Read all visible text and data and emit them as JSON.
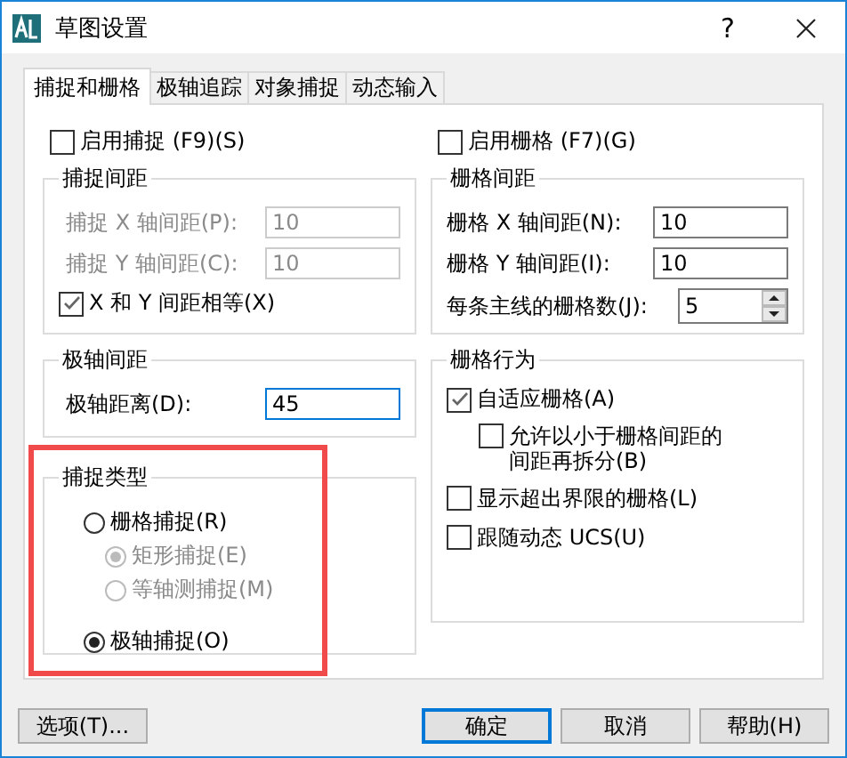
{
  "window": {
    "title": "草图设置",
    "help": "?"
  },
  "tabs": [
    {
      "label": "捕捉和栅格",
      "selected": true
    },
    {
      "label": "极轴追踪",
      "selected": false
    },
    {
      "label": "对象捕捉",
      "selected": false
    },
    {
      "label": "动态输入",
      "selected": false
    }
  ],
  "snap": {
    "enable": {
      "label": "启用捕捉 (F9)(S)",
      "checked": false
    },
    "spacing": {
      "title": "捕捉间距",
      "fields": [
        {
          "label": "捕捉 X 轴间距(P):",
          "value": "10",
          "disabled": true
        },
        {
          "label": "捕捉 Y 轴间距(C):",
          "value": "10",
          "disabled": true
        }
      ],
      "equal": {
        "label": "X 和 Y 间距相等(X)",
        "checked": true
      }
    }
  },
  "polar": {
    "title": "极轴间距",
    "label": "极轴距离(D):",
    "value": "45",
    "focused": true
  },
  "snap_type": {
    "title": "捕捉类型",
    "highlighted": true,
    "options": [
      {
        "label": "栅格捕捉(R)",
        "selected": false,
        "disabled": false,
        "children": [
          {
            "label": "矩形捕捉(E)",
            "selected": true,
            "disabled": true
          },
          {
            "label": "等轴测捕捉(M)",
            "selected": false,
            "disabled": true
          }
        ]
      },
      {
        "label": "极轴捕捉(O)",
        "selected": true,
        "disabled": false
      }
    ]
  },
  "grid": {
    "enable": {
      "label": "启用栅格 (F7)(G)",
      "checked": false
    },
    "spacing": {
      "title": "栅格间距",
      "fields": [
        {
          "label": "栅格 X 轴间距(N):",
          "value": "10",
          "kind": "text"
        },
        {
          "label": "栅格 Y 轴间距(I):",
          "value": "10",
          "kind": "text"
        },
        {
          "label": "每条主线的栅格数(J):",
          "value": "5",
          "kind": "spinner"
        }
      ]
    },
    "behavior": {
      "title": "栅格行为",
      "items": [
        {
          "label": "自适应栅格(A)",
          "checked": true,
          "children": [
            {
              "label": "允许以小于栅格间距的间距再拆分(B)",
              "checked": false
            }
          ]
        },
        {
          "label": "显示超出界限的栅格(L)",
          "checked": false
        },
        {
          "label": "跟随动态 UCS(U)",
          "checked": false
        }
      ]
    }
  },
  "buttons": [
    {
      "label": "选项(T)...",
      "default": false
    },
    {
      "label": "确定",
      "default": true
    },
    {
      "label": "取消",
      "default": false
    },
    {
      "label": "帮助(H)",
      "default": false
    }
  ]
}
